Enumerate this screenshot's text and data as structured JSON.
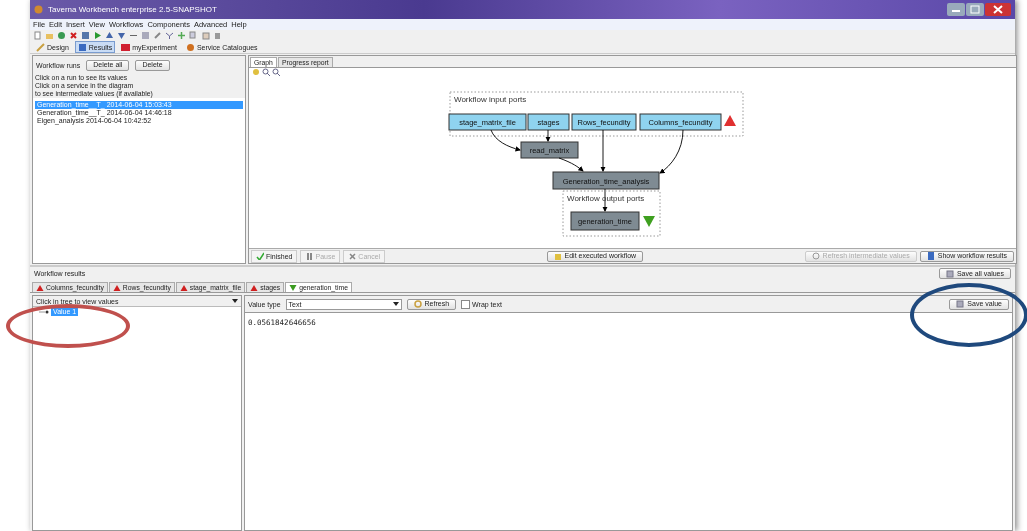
{
  "window": {
    "title": "Taverna Workbench enterprise 2.5-SNAPSHOT"
  },
  "menu": [
    "File",
    "Edit",
    "Insert",
    "View",
    "Workflows",
    "Components",
    "Advanced",
    "Help"
  ],
  "perspectives": [
    {
      "label": "Design",
      "selected": false
    },
    {
      "label": "Results",
      "selected": true
    },
    {
      "label": "myExperiment",
      "selected": false
    },
    {
      "label": "Service Catalogues",
      "selected": false
    }
  ],
  "runs_panel": {
    "title": "Workflow runs",
    "buttons": [
      "Delete all",
      "Delete"
    ],
    "hints": [
      "Click on a run to see its values",
      "Click on a service in the diagram",
      "to see intermediate values (if available)"
    ],
    "runs": [
      {
        "label": "Generation_time__T_ 2014-06-04 15:03:43",
        "selected": true
      },
      {
        "label": "Generation_time__T_ 2014-06-04 14:46:18",
        "selected": false
      },
      {
        "label": "Eigen_analysis 2014-06-04 10:42:52",
        "selected": false
      }
    ]
  },
  "graph_tabs": [
    {
      "label": "Graph",
      "selected": true
    },
    {
      "label": "Progress report",
      "selected": false
    }
  ],
  "diagram": {
    "input_label": "Workflow input ports",
    "inputs": [
      "stage_matrix_file",
      "stages",
      "Rows_fecundity",
      "Columns_fecundity"
    ],
    "processors": [
      "read_matrix",
      "Generation_time_analysis"
    ],
    "output_label": "Workflow output ports",
    "outputs": [
      "generation_time"
    ]
  },
  "run_controls": [
    {
      "label": "Finished",
      "kind": "status",
      "disabled": false
    },
    {
      "label": "Pause",
      "kind": "pause",
      "disabled": true
    },
    {
      "label": "Cancel",
      "kind": "cancel",
      "disabled": true
    }
  ],
  "graph_buttons": [
    {
      "label": "Edit executed workflow",
      "disabled": false
    },
    {
      "label": "Refresh intermediate values",
      "disabled": true
    },
    {
      "label": "Show workflow results",
      "disabled": false
    }
  ],
  "results": {
    "title": "Workflow results",
    "save_all": "Save all values",
    "port_tabs": [
      {
        "label": "Columns_fecundity",
        "kind": "input",
        "selected": false
      },
      {
        "label": "Rows_fecundity",
        "kind": "input",
        "selected": false
      },
      {
        "label": "stage_matrix_file",
        "kind": "input",
        "selected": false
      },
      {
        "label": "stages",
        "kind": "input",
        "selected": false
      },
      {
        "label": "generation_time",
        "kind": "output",
        "selected": true
      }
    ],
    "tree_header": "Click in tree to view values",
    "tree": [
      {
        "label": "Value 1",
        "selected": true
      }
    ],
    "value_type_label": "Value type",
    "value_type": "Text",
    "refresh": "Refresh",
    "wrap_text": {
      "label": "Wrap text",
      "checked": false
    },
    "save_value": "Save value",
    "value": "0.0561842646656"
  },
  "annotations": [
    {
      "color": "#c0504d"
    },
    {
      "color": "#1f497d"
    }
  ]
}
